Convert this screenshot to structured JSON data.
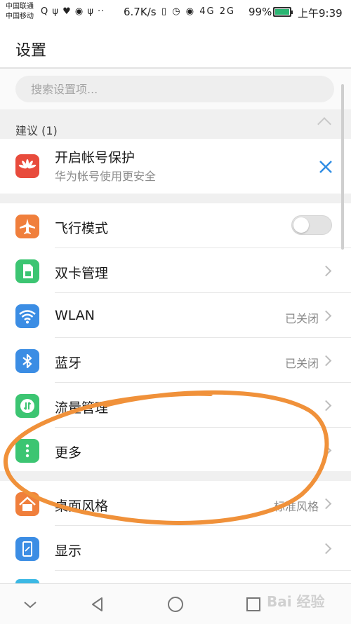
{
  "status_bar": {
    "carrier_1": "中国联通",
    "carrier_2": "中国移动",
    "icons_left": "Q ψ ♥ ◉ ψ ··",
    "net_speed": "6.7K/s",
    "icons_mid": "▯ ◷ ◉ 4G 2G",
    "battery_percent": "99%",
    "time": "上午9:39"
  },
  "header": {
    "title": "设置"
  },
  "search": {
    "placeholder": "搜索设置项..."
  },
  "suggestions": {
    "heading": "建议 (1)",
    "item": {
      "title": "开启帐号保护",
      "subtitle": "华为帐号使用更安全",
      "icon": "huawei-logo-icon"
    }
  },
  "settings": [
    {
      "label": "飞行模式",
      "icon": "airplane-icon",
      "value": "",
      "toggle": false,
      "color": "#f07f3c"
    },
    {
      "label": "双卡管理",
      "icon": "sim-card-icon",
      "value": "",
      "color": "#3cc572"
    },
    {
      "label": "WLAN",
      "icon": "wifi-icon",
      "value": "已关闭",
      "color": "#3b8de4"
    },
    {
      "label": "蓝牙",
      "icon": "bluetooth-icon",
      "value": "已关闭",
      "color": "#3b8de4"
    },
    {
      "label": "流量管理",
      "icon": "data-usage-icon",
      "value": "",
      "color": "#3cc572"
    },
    {
      "label": "更多",
      "icon": "more-dots-icon",
      "value": "",
      "color": "#3cc572"
    },
    {
      "label": "桌面风格",
      "icon": "home-icon",
      "value": "标准风格",
      "color": "#f07f3c"
    },
    {
      "label": "显示",
      "icon": "display-icon",
      "value": "",
      "color": "#3b8de4"
    }
  ],
  "colors": {
    "accent": "#2f8de4",
    "annotation": "#f0913a"
  },
  "watermark": "Bai 经验"
}
